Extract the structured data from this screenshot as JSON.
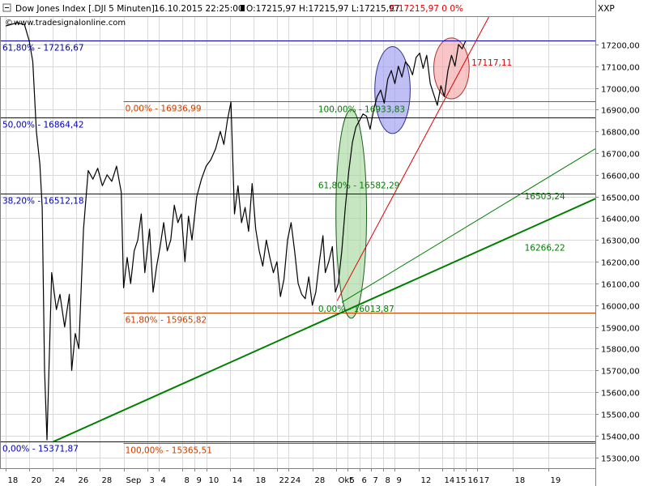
{
  "header": {
    "instrument": "Dow Jones Index [.DJI  5 Minuten]",
    "datetime": "16.10.2015 22:25:00",
    "ohlc": "O:17215,97 H:17215,97 L:17215,97",
    "change": "C:17215,97 0 0%",
    "source": "www.tradesignalonline.com",
    "symbol_tag": "XXP"
  },
  "chart_data": {
    "type": "line",
    "price_axis": {
      "min": 15250,
      "max": 17330,
      "ticks": [
        17200,
        17100,
        17000,
        16900,
        16800,
        16700,
        16600,
        16500,
        16400,
        16300,
        16200,
        16100,
        16000,
        15900,
        15800,
        15700,
        15600,
        15500,
        15400,
        15300
      ],
      "tick_labels": [
        "17200,00",
        "17100,00",
        "17000,00",
        "16900,00",
        "16800,00",
        "16700,00",
        "16600,00",
        "16500,00",
        "16400,00",
        "16300,00",
        "16200,00",
        "16100,00",
        "16000,00",
        "15900,00",
        "15800,00",
        "15700,00",
        "15600,00",
        "15500,00",
        "15400,00",
        "15300,00"
      ]
    },
    "time_axis": {
      "labels": [
        "18",
        "20",
        "24",
        "26",
        "28",
        "Sep",
        "3",
        "4",
        "8",
        "9",
        "10",
        "14",
        "18",
        "22",
        "24",
        "28",
        "Okt",
        "5",
        "6",
        "7",
        "8",
        "9",
        "12",
        "14",
        "15",
        "16",
        "17",
        "18",
        "19"
      ],
      "index": [
        0,
        2,
        4,
        6,
        8,
        10,
        12,
        13,
        15,
        16,
        17,
        19,
        21,
        23,
        24,
        26,
        28,
        29,
        30,
        31,
        32,
        33,
        35,
        37,
        38,
        39,
        40,
        43,
        46
      ],
      "range": [
        0,
        50
      ]
    },
    "series": [
      {
        "color": "#000000",
        "points": [
          [
            0.0,
            17285
          ],
          [
            1.0,
            17300
          ],
          [
            1.6,
            17290
          ],
          [
            2.0,
            17216
          ],
          [
            2.3,
            17120
          ],
          [
            2.6,
            16800
          ],
          [
            2.9,
            16650
          ],
          [
            3.1,
            16450
          ],
          [
            3.3,
            15700
          ],
          [
            3.5,
            15380
          ],
          [
            3.9,
            16150
          ],
          [
            4.3,
            15980
          ],
          [
            4.6,
            16050
          ],
          [
            5.0,
            15900
          ],
          [
            5.4,
            16050
          ],
          [
            5.6,
            15700
          ],
          [
            5.9,
            15870
          ],
          [
            6.2,
            15800
          ],
          [
            6.6,
            16350
          ],
          [
            7.0,
            16620
          ],
          [
            7.4,
            16580
          ],
          [
            7.8,
            16630
          ],
          [
            8.2,
            16550
          ],
          [
            8.6,
            16600
          ],
          [
            9.0,
            16570
          ],
          [
            9.4,
            16640
          ],
          [
            9.8,
            16520
          ],
          [
            10.0,
            16080
          ],
          [
            10.3,
            16220
          ],
          [
            10.6,
            16100
          ],
          [
            10.9,
            16250
          ],
          [
            11.2,
            16300
          ],
          [
            11.5,
            16420
          ],
          [
            11.8,
            16150
          ],
          [
            12.2,
            16350
          ],
          [
            12.5,
            16060
          ],
          [
            12.8,
            16180
          ],
          [
            13.1,
            16270
          ],
          [
            13.4,
            16380
          ],
          [
            13.7,
            16250
          ],
          [
            14.0,
            16300
          ],
          [
            14.3,
            16460
          ],
          [
            14.6,
            16380
          ],
          [
            14.9,
            16420
          ],
          [
            15.2,
            16200
          ],
          [
            15.5,
            16410
          ],
          [
            15.8,
            16300
          ],
          [
            16.2,
            16500
          ],
          [
            16.6,
            16580
          ],
          [
            17.0,
            16640
          ],
          [
            17.4,
            16670
          ],
          [
            17.8,
            16720
          ],
          [
            18.2,
            16800
          ],
          [
            18.5,
            16740
          ],
          [
            18.8,
            16850
          ],
          [
            19.1,
            16935
          ],
          [
            19.4,
            16420
          ],
          [
            19.7,
            16550
          ],
          [
            20.0,
            16380
          ],
          [
            20.3,
            16450
          ],
          [
            20.6,
            16340
          ],
          [
            20.9,
            16560
          ],
          [
            21.2,
            16350
          ],
          [
            21.5,
            16250
          ],
          [
            21.8,
            16180
          ],
          [
            22.1,
            16300
          ],
          [
            22.4,
            16220
          ],
          [
            22.7,
            16150
          ],
          [
            23.0,
            16200
          ],
          [
            23.3,
            16040
          ],
          [
            23.6,
            16120
          ],
          [
            23.9,
            16300
          ],
          [
            24.2,
            16380
          ],
          [
            24.5,
            16250
          ],
          [
            24.8,
            16100
          ],
          [
            25.1,
            16050
          ],
          [
            25.4,
            16030
          ],
          [
            25.7,
            16130
          ],
          [
            26.0,
            16000
          ],
          [
            26.3,
            16060
          ],
          [
            26.6,
            16200
          ],
          [
            26.9,
            16320
          ],
          [
            27.1,
            16150
          ],
          [
            27.4,
            16200
          ],
          [
            27.7,
            16270
          ],
          [
            27.95,
            16060
          ],
          [
            28.2,
            16100
          ],
          [
            28.5,
            16250
          ],
          [
            28.8,
            16450
          ],
          [
            29.1,
            16620
          ],
          [
            29.4,
            16750
          ],
          [
            29.7,
            16820
          ],
          [
            30.0,
            16850
          ],
          [
            30.3,
            16880
          ],
          [
            30.6,
            16870
          ],
          [
            30.9,
            16810
          ],
          [
            31.2,
            16900
          ],
          [
            31.5,
            16960
          ],
          [
            31.8,
            16990
          ],
          [
            32.1,
            16930
          ],
          [
            32.4,
            17040
          ],
          [
            32.7,
            17080
          ],
          [
            33.0,
            17020
          ],
          [
            33.3,
            17100
          ],
          [
            33.6,
            17050
          ],
          [
            33.9,
            17120
          ],
          [
            34.2,
            17100
          ],
          [
            34.5,
            17060
          ],
          [
            34.8,
            17140
          ],
          [
            35.1,
            17160
          ],
          [
            35.4,
            17090
          ],
          [
            35.7,
            17150
          ],
          [
            36.0,
            17020
          ],
          [
            36.3,
            16970
          ],
          [
            36.6,
            16920
          ],
          [
            36.9,
            17010
          ],
          [
            37.2,
            16960
          ],
          [
            37.5,
            17080
          ],
          [
            37.8,
            17150
          ],
          [
            38.1,
            17100
          ],
          [
            38.4,
            17200
          ],
          [
            38.7,
            17180
          ],
          [
            39.0,
            17216
          ]
        ]
      }
    ],
    "horizontal_levels": [
      {
        "value": 17216.67,
        "label": "61,80% - 17216,67",
        "color": "#0000b0",
        "side": "left"
      },
      {
        "value": 16864.42,
        "label": "50,00% - 16864,42",
        "color": "#0000b0",
        "side": "left"
      },
      {
        "value": 16512.18,
        "label": "38,20% - 16512,18",
        "color": "#0000b0",
        "side": "left"
      },
      {
        "value": 15371.87,
        "label": "0,00% - 15371,87",
        "color": "#0000b0",
        "side": "left"
      },
      {
        "value": 16936.99,
        "label": "0,00% - 16936,99",
        "color": "#c84000",
        "side": "mid"
      },
      {
        "value": 15965.82,
        "label": "61,80% - 15965,82",
        "color": "#c84000",
        "side": "mid"
      },
      {
        "value": 15365.51,
        "label": "100,00% - 15365,51",
        "color": "#c84000",
        "side": "mid"
      }
    ],
    "fib_labels": [
      {
        "value": 16933.83,
        "x": 26.5,
        "label": "100,00% - 16933,83",
        "color": "#008000"
      },
      {
        "value": 16582.29,
        "x": 26.5,
        "label": "61,80% - 16582,29",
        "color": "#008000"
      },
      {
        "value": 16013.87,
        "x": 26.5,
        "label": "0,00% - 16013,87",
        "color": "#008000"
      }
    ],
    "trend_lines": [
      {
        "color": "#008000",
        "width": 2,
        "from": [
          4.0,
          15371
        ],
        "to": [
          50,
          16490
        ]
      },
      {
        "color": "#008000",
        "width": 1,
        "from": [
          28.5,
          16013
        ],
        "to": [
          50,
          16720
        ]
      },
      {
        "color": "#dd0000",
        "width": 1,
        "from": [
          28.1,
          16020
        ],
        "to": [
          41.0,
          17330
        ]
      }
    ],
    "line_labels": [
      {
        "value": 16503.24,
        "x": 44.0,
        "label": "16503,24",
        "color": "#008000"
      },
      {
        "value": 16266.22,
        "x": 44.0,
        "label": "16266,22",
        "color": "#008000"
      },
      {
        "value": 17117.11,
        "x": 39.5,
        "label": "17117,11",
        "color": "#dd0000"
      }
    ],
    "ellipses": [
      {
        "cx": 29.3,
        "cy": 16420,
        "rx": 1.3,
        "ry": 480,
        "fill": "#a8d8a0",
        "stroke": "#206020"
      },
      {
        "cx": 32.8,
        "cy": 16990,
        "rx": 1.5,
        "ry": 200,
        "fill": "#9c9cf0",
        "stroke": "#303090"
      },
      {
        "cx": 37.8,
        "cy": 17090,
        "rx": 1.5,
        "ry": 140,
        "fill": "#f4a8a8",
        "stroke": "#b03030"
      }
    ]
  }
}
